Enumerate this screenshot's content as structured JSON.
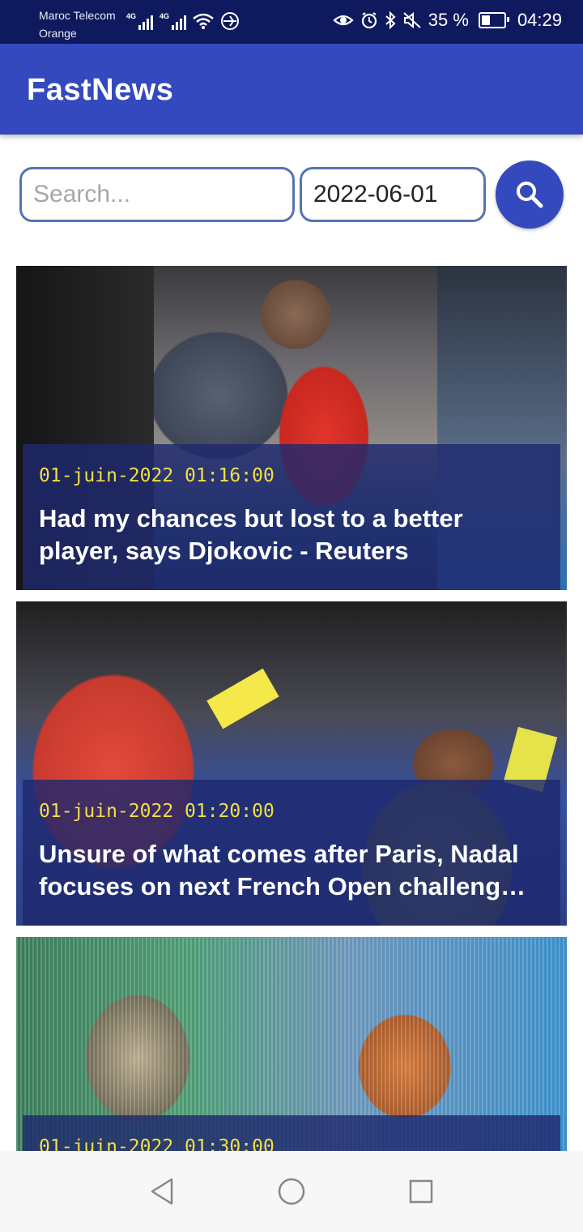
{
  "status_bar": {
    "carrier_1": "Maroc Telecom",
    "carrier_2": "Orange",
    "network_1": "4G",
    "network_2": "4G",
    "battery_percent": "35 %",
    "battery_level": 0.35,
    "time": "04:29",
    "icons": [
      "signal-icon",
      "signal-icon",
      "wifi-icon",
      "vpn-icon",
      "eye-comfort-icon",
      "alarm-icon",
      "bluetooth-icon",
      "mute-icon",
      "battery-icon"
    ]
  },
  "app_bar": {
    "title": "FastNews"
  },
  "search": {
    "placeholder": "Search...",
    "value": "",
    "date_value": "2022-06-01",
    "button_icon": "search-icon"
  },
  "articles": [
    {
      "date": "01-juin-2022 01:16:00",
      "headline": "Had my chances but lost to a better player, says Djokovic - Reuters"
    },
    {
      "date": "01-juin-2022 01:20:00",
      "headline": "Unsure of what comes after Paris, Nadal focuses on next French Open challenge - Reuters"
    },
    {
      "date": "01-juin-2022 01:30:00",
      "headline": ""
    }
  ],
  "nav_bar": {
    "icons": [
      "back-icon",
      "home-icon",
      "recents-icon"
    ]
  },
  "colors": {
    "status_bar": "#0f1a5e",
    "app_bar": "#3449bd",
    "accent": "#3449bd",
    "field_border": "#5574b3",
    "date_text": "#f2df45"
  }
}
